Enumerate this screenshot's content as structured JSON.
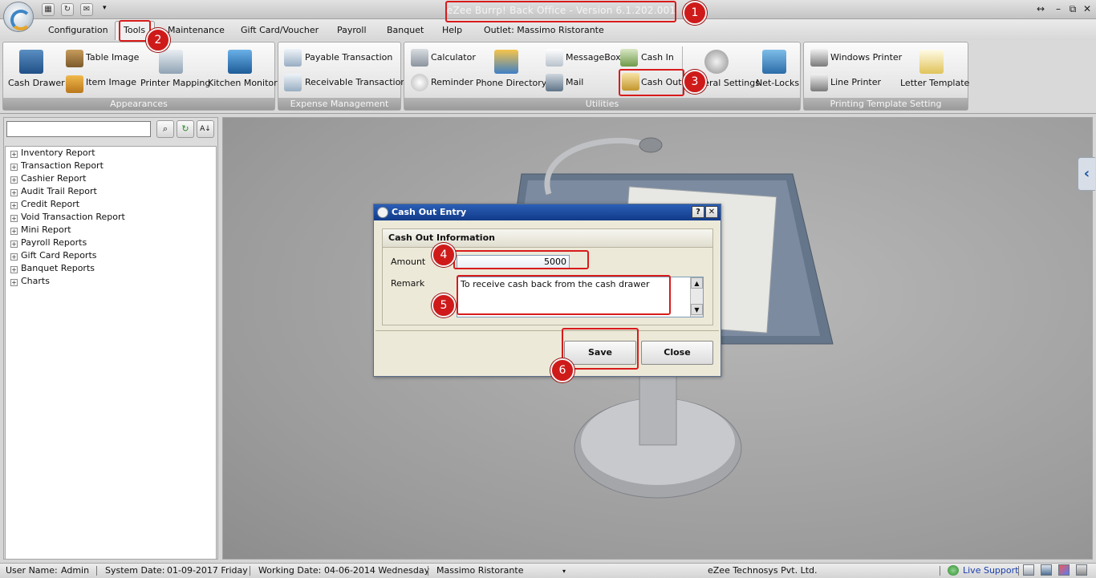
{
  "window": {
    "title": "eZee Burrp! Back Office - Version 6.1.202.001",
    "controls": [
      "resize-icon",
      "minimize-icon",
      "restore-icon",
      "close-icon"
    ]
  },
  "menu": {
    "items": [
      "Configuration",
      "Tools",
      "Maintenance",
      "Gift Card/Voucher",
      "Payroll",
      "Banquet",
      "Help",
      "Outlet: Massimo Ristorante"
    ],
    "active": "Tools"
  },
  "ribbon": {
    "appearances": {
      "label": "Appearances",
      "cash_drawer": "Cash Drawer",
      "table_image": "Table Image",
      "item_image": "Item Image",
      "printer_mapping": "Printer Mapping",
      "kitchen_monitor": "Kitchen Monitor"
    },
    "expense": {
      "label": "Expense Management",
      "payable": "Payable Transaction",
      "receivable": "Receivable Transaction"
    },
    "utilities": {
      "label": "Utilities",
      "calculator": "Calculator",
      "reminder": "Reminder",
      "phone_directory": "Phone Directory",
      "messagebox": "MessageBox",
      "mail": "Mail",
      "cash_in": "Cash In",
      "cash_out": "Cash Out",
      "general_settings": "General Settings",
      "net_locks": "Net-Locks"
    },
    "printing": {
      "label": "Printing Template Setting",
      "windows_printer": "Windows Printer",
      "line_printer": "Line Printer",
      "letter_template": "Letter Template"
    }
  },
  "reports": {
    "search_value": "",
    "items": [
      "Inventory Report",
      "Transaction Report",
      "Cashier Report",
      "Audit Trail Report",
      "Credit Report",
      "Void Transaction Report",
      "Mini Report",
      "Payroll Reports",
      "Gift Card Reports",
      "Banquet Reports",
      "Charts"
    ]
  },
  "dialog": {
    "title": "Cash Out Entry",
    "help": "?",
    "close": "✕",
    "section": "Cash Out Information",
    "amount_label": "Amount",
    "amount_value": "5000",
    "remark_label": "Remark",
    "remark_value": "To receive cash back from the cash drawer",
    "save": "Save",
    "close_button": "Close"
  },
  "annotations": [
    "1",
    "2",
    "3",
    "4",
    "5",
    "6"
  ],
  "status": {
    "user_label": "User Name:",
    "user": "Admin",
    "system_date_label": "System Date:",
    "system_date": "01-09-2017 Friday",
    "working_date_label": "Working Date:",
    "working_date": "04-06-2014 Wednesday",
    "outlet": "Massimo Ristorante",
    "company": "eZee Technosys Pvt. Ltd.",
    "live_support": "Live Support"
  },
  "colors": {
    "highlight": "#d81b1b",
    "dialog_title": "#123a8a",
    "link": "#1a3fb0"
  }
}
